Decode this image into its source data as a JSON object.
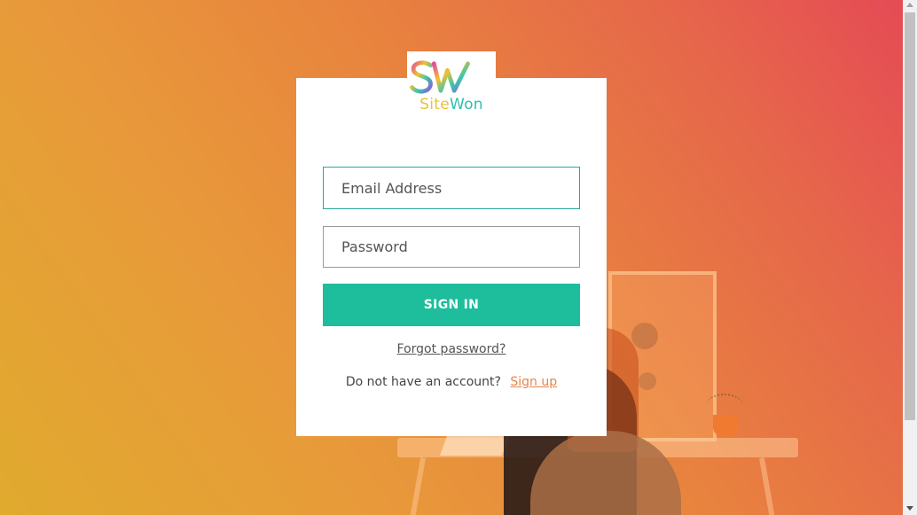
{
  "logo": {
    "mark": "SW",
    "text_part1": "Site",
    "text_part2": "Won"
  },
  "form": {
    "email_placeholder": "Email Address",
    "password_placeholder": "Password",
    "submit_label": "SIGN IN",
    "forgot_label": "Forgot password?",
    "no_account_text": "Do not have an account?",
    "signup_label": "Sign up"
  },
  "colors": {
    "accent": "#1ebd9c",
    "link": "#e8844a",
    "gradient_start": "#e0aa2e",
    "gradient_end": "#e54b55"
  }
}
